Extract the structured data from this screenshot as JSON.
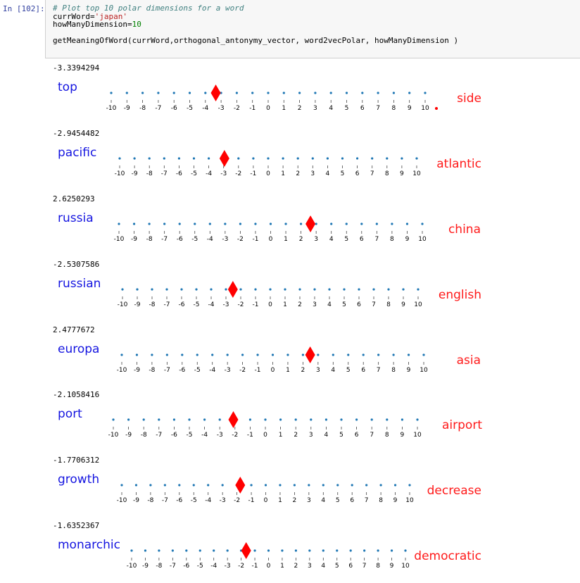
{
  "cell": {
    "prompt": "In [102]:",
    "code_lines": [
      {
        "parts": [
          {
            "t": "# Plot top 10 polar dimensions for a word",
            "c": "c-comment"
          }
        ]
      },
      {
        "parts": [
          {
            "t": "currWord=",
            "c": ""
          },
          {
            "t": "'japan'",
            "c": "c-str"
          }
        ]
      },
      {
        "parts": [
          {
            "t": "howManyDimension=",
            "c": ""
          },
          {
            "t": "10",
            "c": "c-num"
          }
        ]
      },
      {
        "parts": [
          {
            "t": "",
            "c": ""
          }
        ]
      },
      {
        "parts": [
          {
            "t": "getMeaningOfWord(currWord,orthogonal_antonymy_vector, word2vecPolar, howManyDimension )",
            "c": ""
          }
        ]
      }
    ]
  },
  "colors": {
    "dot": "#1f77b4",
    "marker": "#ff0000",
    "left_word": "#1515e0",
    "right_word": "#ff1a1a"
  },
  "tick_labels": [
    "-10",
    "-9",
    "-8",
    "-7",
    "-6",
    "-5",
    "-4",
    "-3",
    "-2",
    "-1",
    "0",
    "1",
    "2",
    "3",
    "4",
    "5",
    "6",
    "7",
    "8",
    "9",
    "10"
  ],
  "chart_data": [
    {
      "type": "scatter",
      "score_text": "-3.3394294",
      "value": -3.3394294,
      "left_word": "top",
      "right_word": "side",
      "xlim": [
        -10,
        10
      ],
      "extra_point": true
    },
    {
      "type": "scatter",
      "score_text": "-2.9454482",
      "value": -2.9454482,
      "left_word": "pacific",
      "right_word": "atlantic",
      "xlim": [
        -10,
        10
      ]
    },
    {
      "type": "scatter",
      "score_text": "2.6250293",
      "value": 2.6250293,
      "left_word": "russia",
      "right_word": "china",
      "xlim": [
        -10,
        10
      ]
    },
    {
      "type": "scatter",
      "score_text": "-2.5307586",
      "value": -2.5307586,
      "left_word": "russian",
      "right_word": "english",
      "xlim": [
        -10,
        10
      ]
    },
    {
      "type": "scatter",
      "score_text": "2.4777672",
      "value": 2.4777672,
      "left_word": "europa",
      "right_word": "asia",
      "xlim": [
        -10,
        10
      ]
    },
    {
      "type": "scatter",
      "score_text": "-2.1058416",
      "value": -2.1058416,
      "left_word": "port",
      "right_word": "airport",
      "xlim": [
        -10,
        10
      ]
    },
    {
      "type": "scatter",
      "score_text": "-1.7706312",
      "value": -1.7706312,
      "left_word": "growth",
      "right_word": "decrease",
      "xlim": [
        -10,
        10
      ]
    },
    {
      "type": "scatter",
      "score_text": "-1.6352367",
      "value": -1.6352367,
      "left_word": "monarchic",
      "right_word": "democratic",
      "xlim": [
        -10,
        10
      ]
    }
  ]
}
